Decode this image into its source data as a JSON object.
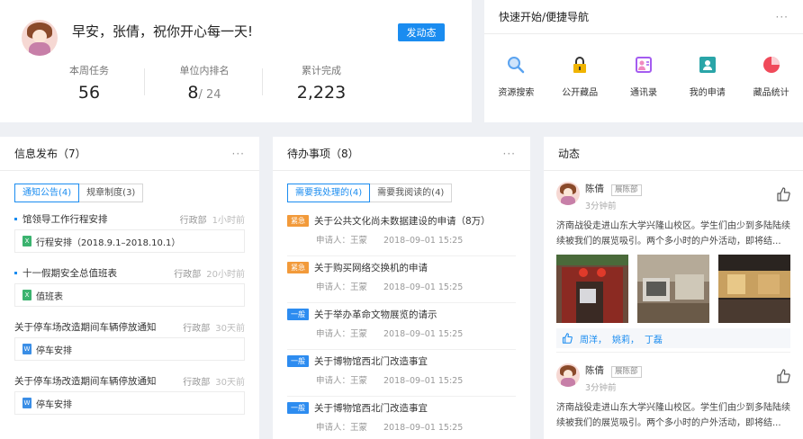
{
  "welcome": {
    "greeting": "早安，张倩，祝你开心每一天!",
    "post_button": "发动态",
    "stats": [
      {
        "label": "本周任务",
        "value": "56",
        "suffix": ""
      },
      {
        "label": "单位内排名",
        "value": "8",
        "suffix": "/ 24"
      },
      {
        "label": "累计完成",
        "value": "2,223",
        "suffix": ""
      }
    ]
  },
  "quicknav": {
    "title": "快速开始/便捷导航",
    "more": "···",
    "items": [
      {
        "label": "资源搜索",
        "icon": "search-icon",
        "color": "#5aa3f0"
      },
      {
        "label": "公开藏品",
        "icon": "lock-icon",
        "color": "#f0b400"
      },
      {
        "label": "通讯录",
        "icon": "contacts-icon",
        "color": "#a45cf0"
      },
      {
        "label": "我的申请",
        "icon": "application-icon",
        "color": "#2aa5a8"
      },
      {
        "label": "藏品统计",
        "icon": "pie-chart-icon",
        "color": "#f04a5a"
      }
    ]
  },
  "info": {
    "title": "信息发布（7）",
    "more": "···",
    "tabs": [
      "通知公告(4)",
      "规章制度(3)"
    ],
    "items": [
      {
        "title": "馆领导工作行程安排",
        "dept": "行政部",
        "time": "1小时前",
        "attachment": "行程安排（2018.9.1–2018.10.1）",
        "type": "X",
        "bullet": true
      },
      {
        "title": "十一假期安全总值班表",
        "dept": "行政部",
        "time": "20小时前",
        "attachment": "值班表",
        "type": "X",
        "bullet": true
      },
      {
        "title": "关于停车场改造期间车辆停放通知",
        "dept": "行政部",
        "time": "30天前",
        "attachment": "停车安排",
        "type": "W",
        "bullet": false
      },
      {
        "title": "关于停车场改造期间车辆停放通知",
        "dept": "行政部",
        "time": "30天前",
        "attachment": "停车安排",
        "type": "W",
        "bullet": false
      }
    ]
  },
  "todo": {
    "title": "待办事项（8）",
    "more": "···",
    "tabs": [
      "需要我处理的(4)",
      "需要我阅读的(4)"
    ],
    "items": [
      {
        "badge": "紧急",
        "level": "urgent",
        "title": "关于公共文化尚未数据建设的申请（8万）",
        "applicant": "申请人：王蒙",
        "date": "2018–09–01 15:25"
      },
      {
        "badge": "紧急",
        "level": "urgent",
        "title": "关于购买网络交换机的申请",
        "applicant": "申请人：王蒙",
        "date": "2018–09–01 15:25"
      },
      {
        "badge": "一般",
        "level": "normal",
        "title": "关于举办革命文物展览的请示",
        "applicant": "申请人：王蒙",
        "date": "2018–09–01 15:25"
      },
      {
        "badge": "一般",
        "level": "normal",
        "title": "关于博物馆西北门改造事宜",
        "applicant": "申请人：王蒙",
        "date": "2018–09–01 15:25"
      },
      {
        "badge": "一般",
        "level": "normal",
        "title": "关于博物馆西北门改造事宜",
        "applicant": "申请人：王蒙",
        "date": "2018–09–01 15:25"
      }
    ]
  },
  "feed": {
    "title": "动态",
    "posts": [
      {
        "name": "陈倩",
        "dept": "展陈部",
        "time": "3分钟前",
        "text": "济南战役走进山东大学兴隆山校区。学生们由少到多陆陆续续被我们的展览吸引。两个多小时的户外活动，即将结...",
        "likes": [
          "周洋，",
          "姚莉，",
          "丁磊"
        ]
      },
      {
        "name": "陈倩",
        "dept": "展陈部",
        "time": "3分钟前",
        "text": "济南战役走进山东大学兴隆山校区。学生们由少到多陆陆续续被我们的展览吸引。两个多小时的户外活动，即将结...",
        "likes": []
      }
    ]
  }
}
